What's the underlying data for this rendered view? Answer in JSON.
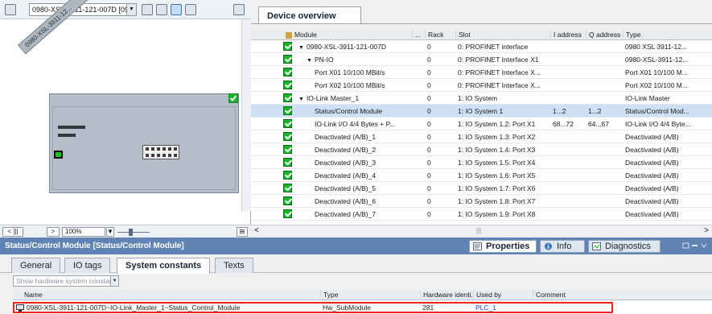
{
  "toolbar": {
    "device_select": "0980-XSL-3911-121-007D [09"
  },
  "canvas": {
    "rotated_label": "0980-XSL-3911-12..."
  },
  "left_status": {
    "zoom": "100%"
  },
  "overview": {
    "tab_title": "Device overview",
    "columns": {
      "module": "Module",
      "dots": "...",
      "rack": "Rack",
      "slot": "Slot",
      "iaddr": "I address",
      "qaddr": "Q address",
      "type": "Type"
    },
    "rows": [
      {
        "module": "0980-XSL-3911-121-007D",
        "tri": "▼",
        "indent": 0,
        "rack": "0",
        "slot": "0: PROFINET interface",
        "iaddr": "",
        "qaddr": "",
        "type": "0980 XSL 3911-12..."
      },
      {
        "module": "PN-IO",
        "tri": "▼",
        "indent": 1,
        "rack": "0",
        "slot": "0: PROFINET Interface X1",
        "iaddr": "",
        "qaddr": "",
        "type": "0980-XSL-3911-12..."
      },
      {
        "module": "Port X01 10/100 MBit/s",
        "tri": "",
        "indent": 2,
        "rack": "0",
        "slot": "0: PROFINET Interface X...",
        "iaddr": "",
        "qaddr": "",
        "type": "Port X01 10/100 M..."
      },
      {
        "module": "Port X02 10/100 MBit/s",
        "tri": "",
        "indent": 2,
        "rack": "0",
        "slot": "0: PROFINET Interface X...",
        "iaddr": "",
        "qaddr": "",
        "type": "Port X02 10/100 M..."
      },
      {
        "module": "IO-Link Master_1",
        "tri": "▼",
        "indent": 0,
        "rack": "0",
        "slot": "1: IO System",
        "iaddr": "",
        "qaddr": "",
        "type": "IO-Link Master"
      },
      {
        "module": "Status/Control Module",
        "tri": "",
        "indent": 2,
        "rack": "0",
        "slot": "1: IO System 1",
        "iaddr": "1...2",
        "qaddr": "1...2",
        "type": "Status/Control Mod..."
      },
      {
        "module": "IO-Link I/O 4/4 Bytes + P...",
        "tri": "",
        "indent": 2,
        "rack": "0",
        "slot": "1: IO System 1.2: Port X1",
        "iaddr": "68...72",
        "qaddr": "64...67",
        "type": "IO-Link I/O 4/4 Byte..."
      },
      {
        "module": "Deactivated (A/B)_1",
        "tri": "",
        "indent": 2,
        "rack": "0",
        "slot": "1: IO System 1.3: Port X2",
        "iaddr": "",
        "qaddr": "",
        "type": "Deactivated (A/B)"
      },
      {
        "module": "Deactivated (A/B)_2",
        "tri": "",
        "indent": 2,
        "rack": "0",
        "slot": "1: IO System 1.4: Port X3",
        "iaddr": "",
        "qaddr": "",
        "type": "Deactivated (A/B)"
      },
      {
        "module": "Deactivated (A/B)_3",
        "tri": "",
        "indent": 2,
        "rack": "0",
        "slot": "1: IO System 1.5: Port X4",
        "iaddr": "",
        "qaddr": "",
        "type": "Deactivated (A/B)"
      },
      {
        "module": "Deactivated (A/B)_4",
        "tri": "",
        "indent": 2,
        "rack": "0",
        "slot": "1: IO System 1.6: Port X5",
        "iaddr": "",
        "qaddr": "",
        "type": "Deactivated (A/B)"
      },
      {
        "module": "Deactivated (A/B)_5",
        "tri": "",
        "indent": 2,
        "rack": "0",
        "slot": "1: IO System 1.7: Port X6",
        "iaddr": "",
        "qaddr": "",
        "type": "Deactivated (A/B)"
      },
      {
        "module": "Deactivated (A/B)_6",
        "tri": "",
        "indent": 2,
        "rack": "0",
        "slot": "1: IO System 1.8: Port X7",
        "iaddr": "",
        "qaddr": "",
        "type": "Deactivated (A/B)"
      },
      {
        "module": "Deactivated (A/B)_7",
        "tri": "",
        "indent": 2,
        "rack": "0",
        "slot": "1: IO System 1.9: Port X8",
        "iaddr": "",
        "qaddr": "",
        "type": "Deactivated (A/B)"
      }
    ],
    "selected_row": 5
  },
  "inspector": {
    "title": "Status/Control Module [Status/Control Module]",
    "tabs": {
      "properties": "Properties",
      "info": "Info",
      "diagnostics": "Diagnostics"
    },
    "subtabs": {
      "general": "General",
      "io_tags": "IO tags",
      "system_constants": "System constants",
      "texts": "Texts"
    },
    "filter_placeholder": "Show hardware system constant",
    "columns": {
      "name": "Name",
      "type": "Type",
      "hw_id": "Hardware identi...",
      "used_by": "Used by",
      "comment": "Comment"
    },
    "row": {
      "name": "0980-XSL-3911-121-007D~IO-Link_Master_1~Status_Control_Module",
      "type": "Hw_SubModule",
      "hw_id": "281",
      "used_by": "PLC_1",
      "comment": ""
    }
  },
  "colors": {
    "ok_green": "#18b22b",
    "inspector_header": "#5f83b3",
    "highlight_red": "#e8261f",
    "selected_row": "#cde0f5"
  }
}
